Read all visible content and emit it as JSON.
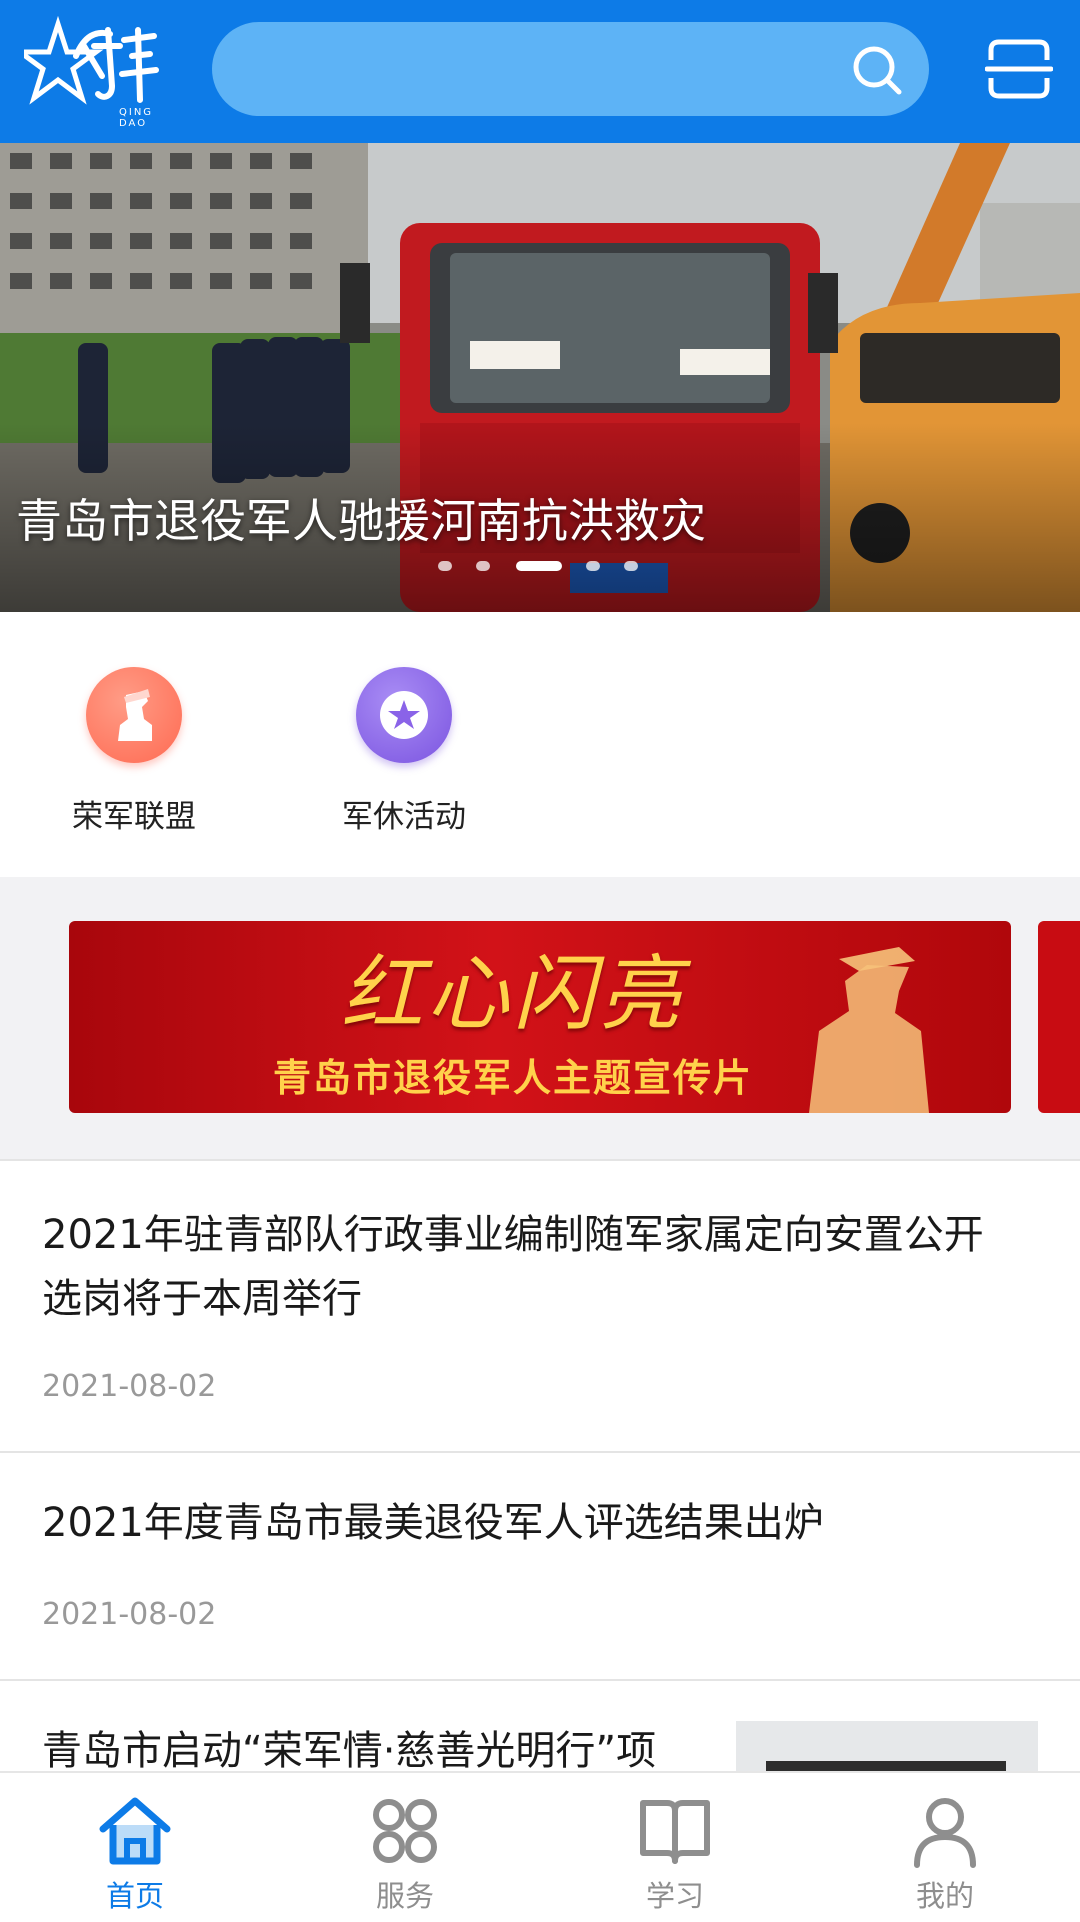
{
  "header": {
    "logo_text": "QING DAO",
    "search_placeholder": "",
    "brand_color": "#0d7be7"
  },
  "banner": {
    "caption": "青岛市退役军人驰援河南抗洪救灾",
    "slide_count": 5,
    "active_slide": 3
  },
  "quick_links": [
    {
      "label": "荣军联盟",
      "icon": "soldier-icon",
      "color": "#ff7a63"
    },
    {
      "label": "军休活动",
      "icon": "star-icon",
      "color": "#8a63e8"
    }
  ],
  "promo": {
    "title": "红心闪亮",
    "subtitle": "青岛市退役军人主题宣传片"
  },
  "news": [
    {
      "title": "2021年驻青部队行政事业编制随军家属定向安置公开选岗将于本周举行",
      "date": "2021-08-02"
    },
    {
      "title": "2021年度青岛市最美退役军人评选结果出炉",
      "date": "2021-08-02"
    },
    {
      "title": "青岛市启动“荣军情·慈善光明行”项",
      "date": ""
    }
  ],
  "tabs": [
    {
      "label": "首页",
      "icon": "home-icon",
      "active": true
    },
    {
      "label": "服务",
      "icon": "grid-icon",
      "active": false
    },
    {
      "label": "学习",
      "icon": "book-icon",
      "active": false
    },
    {
      "label": "我的",
      "icon": "user-icon",
      "active": false
    }
  ]
}
